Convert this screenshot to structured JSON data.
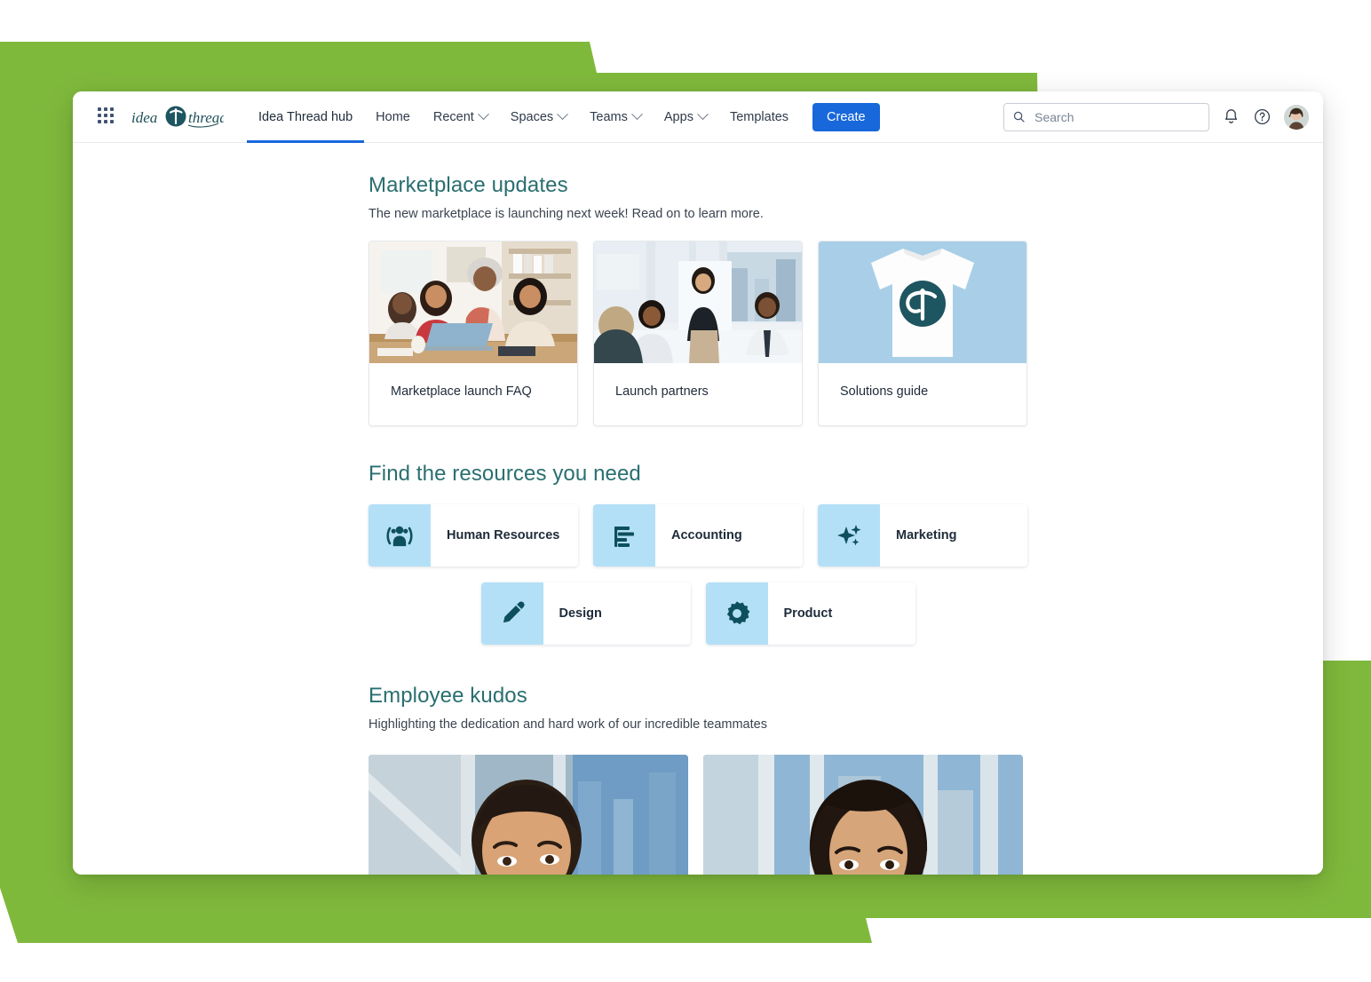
{
  "theme": {
    "green": "#7FB93C",
    "teal_heading": "#2a6f70",
    "accent_blue": "#1868db",
    "tile_blue": "#b3e0f7",
    "icon_teal": "#0e4f5e"
  },
  "nav": {
    "app_grid_icon": "app-switcher-grid-icon",
    "logo_text": "idea thread",
    "links": [
      {
        "label": "Idea Thread hub",
        "active": true,
        "has_caret": false
      },
      {
        "label": "Home",
        "active": false,
        "has_caret": false
      },
      {
        "label": "Recent",
        "active": false,
        "has_caret": true
      },
      {
        "label": "Spaces",
        "active": false,
        "has_caret": true
      },
      {
        "label": "Teams",
        "active": false,
        "has_caret": true
      },
      {
        "label": "Apps",
        "active": false,
        "has_caret": true
      },
      {
        "label": "Templates",
        "active": false,
        "has_caret": false
      }
    ],
    "create_label": "Create",
    "search": {
      "placeholder": "Search",
      "value": "",
      "icon": "search-icon"
    },
    "notifications_icon": "bell-icon",
    "help_icon": "question-circle-icon",
    "avatar": "user-avatar"
  },
  "marketplace": {
    "title": "Marketplace updates",
    "subtitle": "The new marketplace is launching next week! Read on to learn more.",
    "cards": [
      {
        "label": "Marketplace launch FAQ",
        "image": "photo-three-women-at-laptop"
      },
      {
        "label": "Launch partners",
        "image": "photo-team-meeting-office"
      },
      {
        "label": "Solutions guide",
        "image": "photo-white-tshirt-with-logo"
      }
    ]
  },
  "resources": {
    "title": "Find the resources you need",
    "row1": [
      {
        "label": "Human Resources",
        "icon": "people-group-icon"
      },
      {
        "label": "Accounting",
        "icon": "bar-list-icon"
      },
      {
        "label": "Marketing",
        "icon": "sparkle-icon"
      }
    ],
    "row2": [
      {
        "label": "Design",
        "icon": "pencil-icon"
      },
      {
        "label": "Product",
        "icon": "gear-icon"
      }
    ]
  },
  "kudos": {
    "title": "Employee kudos",
    "subtitle": "Highlighting the dedication and hard work of our incredible teammates",
    "cards": [
      {
        "image": "photo-smiling-man-rooftop"
      },
      {
        "image": "photo-smiling-woman-rooftop"
      }
    ]
  }
}
